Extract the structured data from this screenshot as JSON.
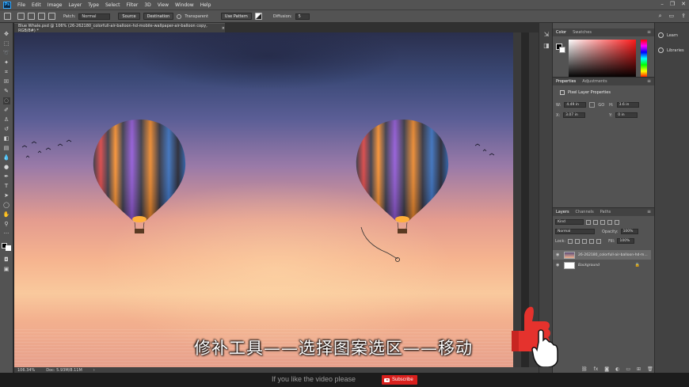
{
  "menubar": {
    "logo": "Ps",
    "items": [
      "File",
      "Edit",
      "Image",
      "Layer",
      "Type",
      "Select",
      "Filter",
      "3D",
      "View",
      "Window",
      "Help"
    ]
  },
  "options": {
    "patch_label": "Patch:",
    "patch_value": "Normal",
    "source_label": "Source",
    "destination_label": "Destination",
    "transparent_label": "Transparent",
    "use_pattern_label": "Use Pattern",
    "diffusion_label": "Diffusion:",
    "diffusion_value": "5"
  },
  "document": {
    "tab_title": "Blue Whale.psd @ 106% (26-262180_colorfull-air-balloon-hd-mobile-wallpaper-air-balloon copy, RGB/8#) *",
    "zoom": "106.34%",
    "doc_info": "Doc: 5.93M/8.11M"
  },
  "color_panel": {
    "tabs": [
      "Color",
      "Swatches"
    ]
  },
  "properties_panel": {
    "tabs": [
      "Properties",
      "Adjustments"
    ],
    "title": "Pixel Layer Properties",
    "w_label": "W:",
    "w_value": "4.49 in",
    "h_label": "H:",
    "h_value": "3.6 in",
    "go_label": "GO",
    "x_label": "X:",
    "x_value": "3.07 in",
    "y_label": "Y:",
    "y_value": "0 in"
  },
  "layers_panel": {
    "tabs": [
      "Layers",
      "Channels",
      "Paths"
    ],
    "kind_label": "Kind",
    "blend_mode": "Normal",
    "opacity_label": "Opacity:",
    "opacity_value": "100%",
    "lock_label": "Lock:",
    "fill_label": "Fill:",
    "fill_value": "100%",
    "layers": [
      {
        "name": "26-262180_colorfull-air-balloon-hd-m...",
        "selected": true
      },
      {
        "name": "Background",
        "selected": false
      }
    ]
  },
  "far_right": {
    "learn": "Learn",
    "libraries": "Libraries"
  },
  "overlay": {
    "subtitle": "修补工具——选择图案选区——移动",
    "like_text": "If you like the video please",
    "subscribe": "Subscribe"
  },
  "colors": {
    "accent": "#31a8ff",
    "subscribe_red": "#d9201d",
    "panel_bg": "#535353"
  }
}
